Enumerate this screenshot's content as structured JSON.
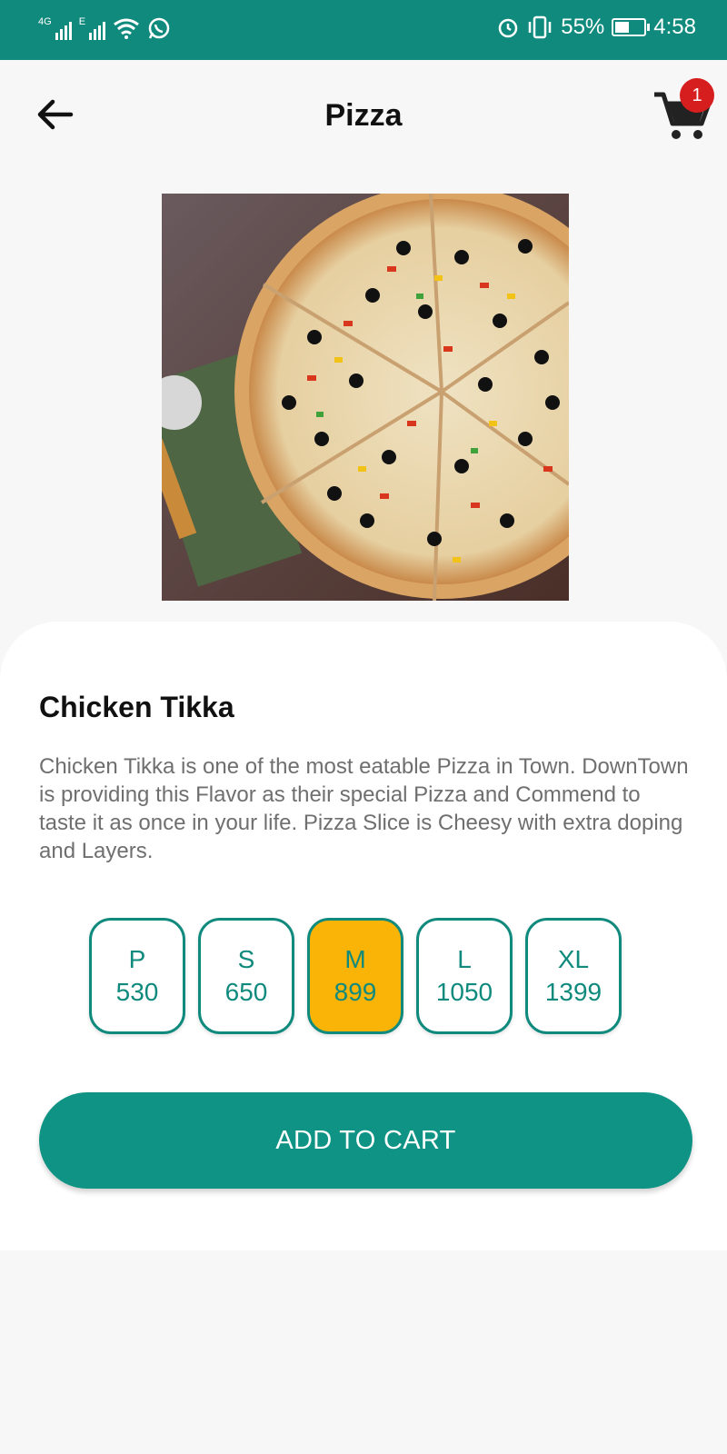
{
  "status_bar": {
    "network_1": "4G",
    "network_2": "E",
    "battery": "55%",
    "time": "4:58",
    "battery_level": 0.55,
    "icons": [
      "signal-icon",
      "signal-icon",
      "wifi-icon",
      "whatsapp-icon",
      "alarm-icon",
      "vibrate-icon",
      "battery-icon"
    ]
  },
  "header": {
    "title": "Pizza",
    "cart_count": "1",
    "icons": [
      "back-arrow-icon",
      "cart-icon"
    ]
  },
  "product": {
    "name": "Chicken Tikka",
    "description": "Chicken Tikka is one of the most eatable Pizza in Town. DownTown is providing this Flavor as their special Pizza and Commend to taste it as once in your life. Pizza Slice is Cheesy with extra doping and Layers.",
    "sizes": [
      {
        "label": "P",
        "price": "530"
      },
      {
        "label": "S",
        "price": "650"
      },
      {
        "label": "M",
        "price": "899"
      },
      {
        "label": "L",
        "price": "1050"
      },
      {
        "label": "XL",
        "price": "1399"
      }
    ],
    "selected_size": "M"
  },
  "actions": {
    "add_to_cart": "ADD TO CART"
  },
  "colors": {
    "primary": "#118a7e",
    "button": "#0f9384",
    "selected": "#f9b407",
    "badge": "#d61e1e"
  }
}
